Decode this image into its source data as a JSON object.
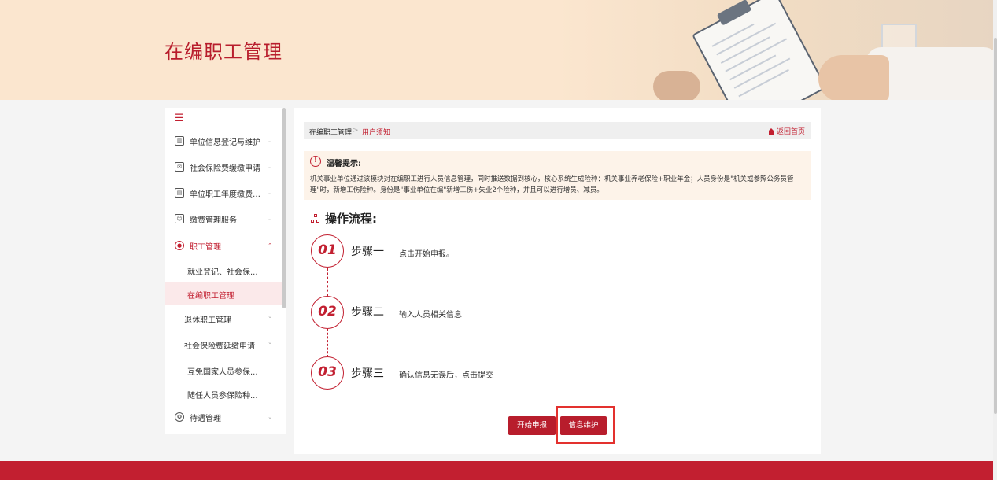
{
  "page": {
    "title": "在编职工管理"
  },
  "sidebar": {
    "toggle_icon": "menu-fold-icon",
    "items": [
      {
        "label": "单位信息登记与维护",
        "icon": "building-icon"
      },
      {
        "label": "社会保险费缓缴申请",
        "icon": "envelope-icon"
      },
      {
        "label": "单位职工年度缴费工...",
        "icon": "id-card-icon"
      },
      {
        "label": "缴费管理服务",
        "icon": "user-card-icon"
      },
      {
        "label": "职工管理",
        "icon": "user-circle-icon"
      }
    ],
    "sub_items": [
      {
        "label": "就业登记、社会保..."
      },
      {
        "label": "在编职工管理"
      },
      {
        "label": "退休职工管理"
      },
      {
        "label": "社会保险费延缴申请"
      },
      {
        "label": "互免国家人员参保..."
      },
      {
        "label": "随任人员参保险种..."
      }
    ],
    "last_item": {
      "label": "待遇管理",
      "icon": "medal-icon"
    }
  },
  "breadcrumb": {
    "parent": "在编职工管理",
    "separator": ">",
    "current": "用户须知",
    "home_link": "返回首页"
  },
  "notice": {
    "title": "温馨提示:",
    "text": "机关事业单位通过该模块对在编职工进行人员信息管理，同时推送数据到核心，核心系统生成险种：机关事业养老保险+职业年金；人员身份是\"机关或参照公务员管理\"时，新增工伤险种。身份是\"事业单位在编\"新增工伤+失业2个险种，并且可以进行增员、减员。"
  },
  "flow": {
    "heading": "操作流程:",
    "steps": [
      {
        "num": "01",
        "title": "步骤一",
        "desc": "点击开始申报。"
      },
      {
        "num": "02",
        "title": "步骤二",
        "desc": "输入人员相关信息"
      },
      {
        "num": "03",
        "title": "步骤三",
        "desc": "确认信息无误后，点击提交"
      }
    ]
  },
  "buttons": {
    "start": "开始申报",
    "maintain": "信息维护"
  },
  "colors": {
    "accent": "#c21f30",
    "banner_bg": "#fbe6cf",
    "notice_bg": "#fdf3e9",
    "highlight": "#e3312e"
  }
}
